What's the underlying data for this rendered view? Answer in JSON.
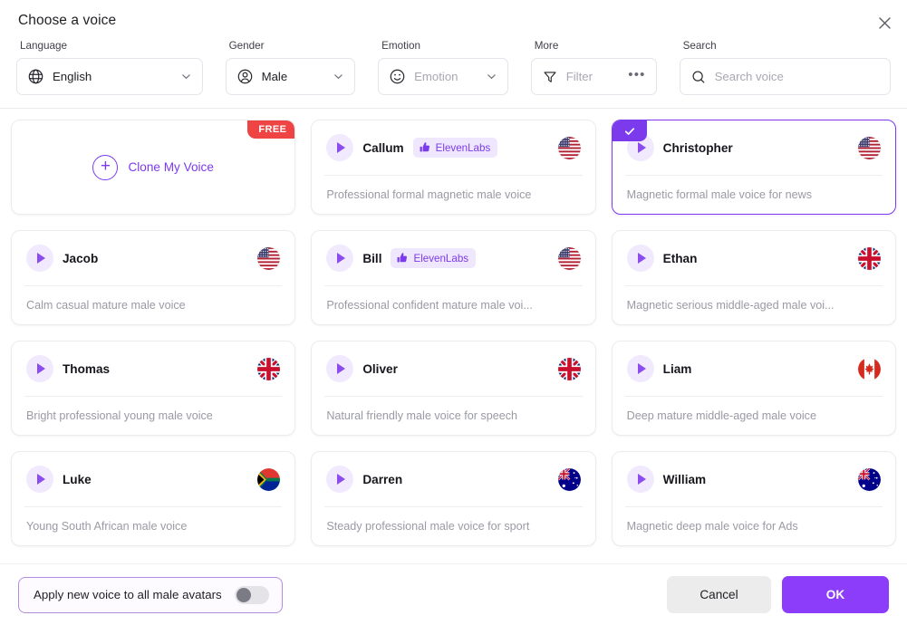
{
  "dialog": {
    "title": "Choose a voice",
    "close_icon": "close-icon"
  },
  "filters": {
    "language": {
      "label": "Language",
      "value": "English",
      "icon": "globe-icon"
    },
    "gender": {
      "label": "Gender",
      "value": "Male",
      "icon": "user-circle-icon"
    },
    "emotion": {
      "label": "Emotion",
      "placeholder": "Emotion",
      "value": "",
      "icon": "smiley-icon"
    },
    "more": {
      "label": "More",
      "placeholder": "Filter",
      "value": "",
      "icon": "funnel-icon",
      "overflow": "•••"
    },
    "search": {
      "label": "Search",
      "placeholder": "Search voice",
      "value": "",
      "icon": "search-icon"
    }
  },
  "clone_card": {
    "label": "Clone My Voice",
    "tag": "FREE",
    "icon": "plus-circle-icon"
  },
  "voices": [
    {
      "name": "Callum",
      "provider": "ElevenLabs",
      "flag": "us",
      "desc": "Professional formal magnetic male voice",
      "selected": false
    },
    {
      "name": "Christopher",
      "provider": "",
      "flag": "us",
      "desc": "Magnetic formal male voice for news",
      "selected": true
    },
    {
      "name": "Jacob",
      "provider": "",
      "flag": "us",
      "desc": "Calm casual mature male voice",
      "selected": false
    },
    {
      "name": "Bill",
      "provider": "ElevenLabs",
      "flag": "us",
      "desc": "Professional confident mature male voi...",
      "selected": false
    },
    {
      "name": "Ethan",
      "provider": "",
      "flag": "gb",
      "desc": "Magnetic serious middle-aged male voi...",
      "selected": false
    },
    {
      "name": "Thomas",
      "provider": "",
      "flag": "gb",
      "desc": "Bright professional young male voice",
      "selected": false
    },
    {
      "name": "Oliver",
      "provider": "",
      "flag": "gb",
      "desc": "Natural friendly male voice for speech",
      "selected": false
    },
    {
      "name": "Liam",
      "provider": "",
      "flag": "ca",
      "desc": "Deep mature middle-aged male voice",
      "selected": false
    },
    {
      "name": "Luke",
      "provider": "",
      "flag": "za",
      "desc": "Young South African male voice",
      "selected": false
    },
    {
      "name": "Darren",
      "provider": "",
      "flag": "au",
      "desc": "Steady professional male voice for sport",
      "selected": false
    },
    {
      "name": "William",
      "provider": "",
      "flag": "au",
      "desc": "Magnetic deep male voice for Ads",
      "selected": false
    }
  ],
  "footer": {
    "apply_label": "Apply new voice to all male avatars",
    "toggle_on": false,
    "cancel_label": "Cancel",
    "ok_label": "OK"
  },
  "colors": {
    "accent": "#7c3aed",
    "ok_button": "#8b3dfa",
    "free_tag": "#ef4444",
    "badge_bg": "#efe7fd"
  }
}
